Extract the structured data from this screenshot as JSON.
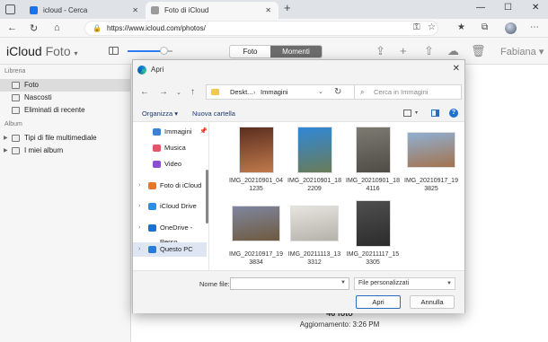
{
  "browser": {
    "tabs": [
      {
        "label": "icloud - Cerca",
        "favicon_color": "#1a73e8"
      },
      {
        "label": "Foto di iCloud",
        "favicon_color": "#9c9c9c"
      }
    ],
    "url": "https://www.icloud.com/photos/"
  },
  "app": {
    "brand": "iCloud",
    "section": "Foto",
    "segments": [
      "Foto",
      "Momenti"
    ],
    "active_segment": "Momenti",
    "zoom_level": 0.8,
    "user": "Fabiana"
  },
  "sidebar": {
    "library_heading": "Libreria",
    "library_items": [
      {
        "label": "Foto",
        "selected": true
      },
      {
        "label": "Nascosti",
        "selected": false
      },
      {
        "label": "Eliminati di recente",
        "selected": false
      }
    ],
    "album_heading": "Album",
    "album_items": [
      {
        "label": "Tipi di file multimediale"
      },
      {
        "label": "I miei album"
      }
    ]
  },
  "main": {
    "count_partial": "46 foto",
    "updated": "Aggiornamento: 3:26 PM"
  },
  "dialog": {
    "title": "Apri",
    "path": [
      "Deskt...",
      "Immagini"
    ],
    "search_placeholder": "Cerca in Immagini",
    "organize_label": "Organizza",
    "new_folder_label": "Nuova cartella",
    "nav_items": [
      {
        "label": "Immagini",
        "pinned": true,
        "color": "#3b82d6"
      },
      {
        "label": "Musica",
        "color": "#e0566b"
      },
      {
        "label": "Video",
        "color": "#8a4fd6"
      },
      {
        "label": "Foto di iCloud",
        "color": "#e07b2e"
      },
      {
        "label": "iCloud Drive",
        "color": "#2f8ee0"
      },
      {
        "label": "OneDrive - Perso",
        "color": "#1f6fd1"
      },
      {
        "label": "Questo PC",
        "color": "#2a7bd6",
        "selected": true
      }
    ],
    "files": [
      {
        "name": "IMG_20210901_041235",
        "colors": [
          "#5b2e1f",
          "#c07a4c"
        ],
        "portrait": true
      },
      {
        "name": "IMG_20210901_182209",
        "colors": [
          "#2f88d8",
          "#6a7b58"
        ],
        "portrait": true
      },
      {
        "name": "IMG_20210901_184116",
        "colors": [
          "#7d7a72",
          "#4f4c45"
        ],
        "portrait": true
      },
      {
        "name": "IMG_20210917_193825",
        "colors": [
          "#8fb0d2",
          "#a3734e"
        ],
        "portrait": false
      },
      {
        "name": "IMG_20210917_193834",
        "colors": [
          "#7f86a0",
          "#6e5a3e"
        ],
        "portrait": false
      },
      {
        "name": "IMG_20211113_133312",
        "colors": [
          "#e6e4de",
          "#b5b2aa"
        ],
        "portrait": false
      },
      {
        "name": "IMG_20211117_153305",
        "colors": [
          "#4f4f4f",
          "#2c2c2c"
        ],
        "portrait": true
      }
    ],
    "filename_label": "Nome file:",
    "filename_value": "",
    "filetype": "File personalizzati",
    "open_label": "Apri",
    "cancel_label": "Annulla"
  }
}
